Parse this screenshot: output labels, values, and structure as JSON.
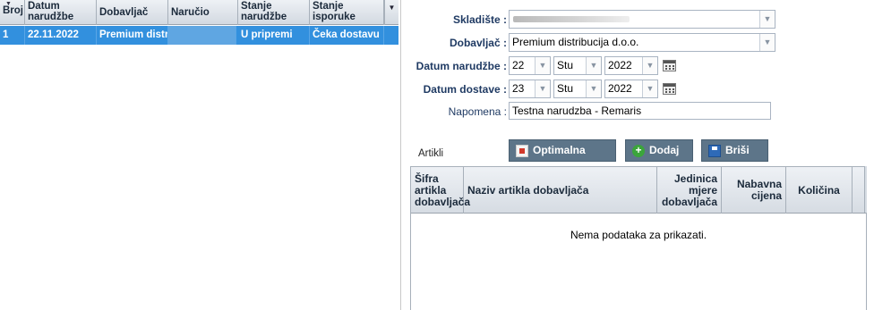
{
  "orders_grid": {
    "columns": [
      "Broj",
      "Datum narudžbe",
      "Dobavljač",
      "Naručio",
      "Stanje narudžbe",
      "Stanje isporuke"
    ],
    "rows": [
      {
        "broj": "1",
        "datum": "22.11.2022",
        "dobavljac": "Premium distr…",
        "narucio": "",
        "stanje_narudzbe": "U pripremi",
        "stanje_isporuke": "Čeka dostavu"
      }
    ]
  },
  "form": {
    "skladiste_label": "Skladište :",
    "skladiste_value": "",
    "dobavljac_label": "Dobavljač :",
    "dobavljac_value": "Premium distribucija d.o.o.",
    "datum_narudzbe_label": "Datum narudžbe :",
    "datum_narudzbe": {
      "day": "22",
      "month": "Stu",
      "year": "2022"
    },
    "datum_dostave_label": "Datum dostave :",
    "datum_dostave": {
      "day": "23",
      "month": "Stu",
      "year": "2022"
    },
    "napomena_label": "Napomena :",
    "napomena_value": "Testna narudzba - Remaris"
  },
  "toolbar": {
    "artikli_label": "Artikli",
    "optimalna_label": "Optimalna zaliha",
    "dodaj_label": "Dodaj",
    "brisi_label": "Briši"
  },
  "articles_grid": {
    "col_sifra": "Šifra artikla dobavljača",
    "col_naziv": "Naziv artikla dobavljača",
    "col_jedinica": "Jedinica mjere dobavljača",
    "col_nabavna": "Nabavna cijena",
    "col_kolicina": "Količina",
    "empty_text": "Nema podataka za prikazati."
  },
  "colors": {
    "selected_row": "#3290de",
    "label_blue": "#1f3a63",
    "toolbar_button": "#5d7589"
  },
  "icons": [
    "sort-arrow-icon",
    "column-menu-icon",
    "dropdown-arrow-icon",
    "calendar-icon",
    "optimal-stock-icon",
    "add-icon",
    "save-delete-icon"
  ]
}
